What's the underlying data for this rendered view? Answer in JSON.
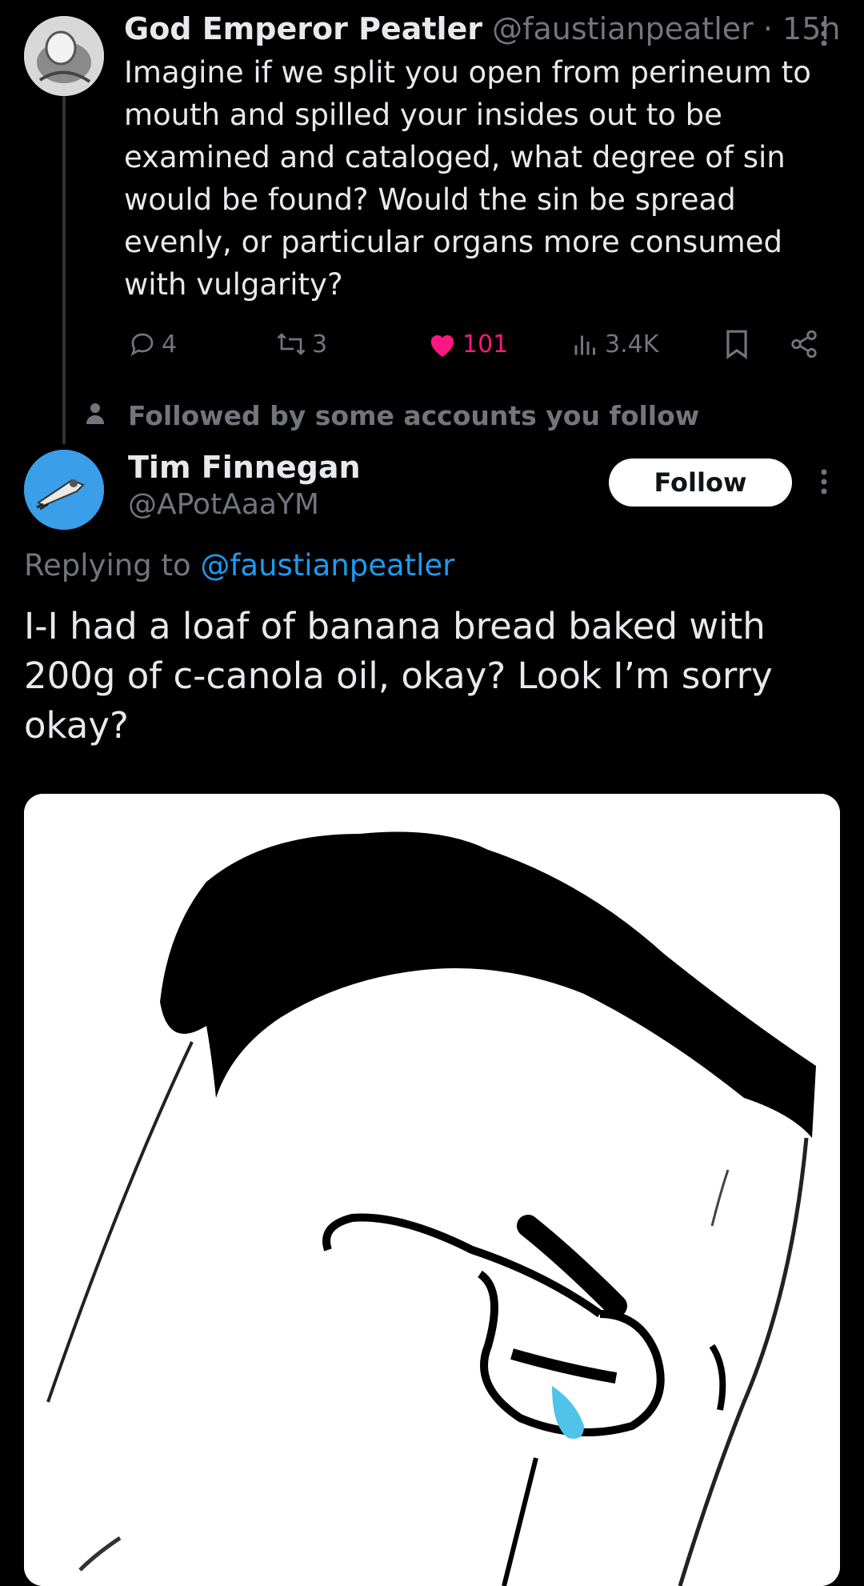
{
  "parent_tweet": {
    "author_name": "God Emperor Peatler",
    "author_handle": "@faustianpeatler",
    "separator": "·",
    "time": "15h",
    "text": "Imagine if we split you open from perineum to mouth and spilled your insides out to be examined and cataloged, what degree of sin would be found? Would the sin be spread evenly, or particular organs more consumed with vulgarity?",
    "replies": "4",
    "reposts": "3",
    "likes": "101",
    "views": "3.4K",
    "like_color": "#f91880",
    "icons": [
      "reply-icon",
      "repost-icon",
      "heart-icon",
      "views-icon",
      "bookmark-icon",
      "share-icon",
      "more-icon"
    ]
  },
  "social_context": {
    "text": "Followed by some accounts you follow",
    "icon": "person-icon"
  },
  "reply_tweet": {
    "author_name": "Tim Finnegan",
    "author_handle": "@APotAaaYM",
    "follow_label": "Follow",
    "replying_prefix": "Replying to",
    "replying_mention": "@faustianpeatler",
    "text": "I-I had a loaf of banana bread baked with 200g of c-canola oil, okay? Look I’m sorry okay?",
    "mention_color": "#1d9bf0",
    "avatar_color": "#3a9ee8"
  }
}
